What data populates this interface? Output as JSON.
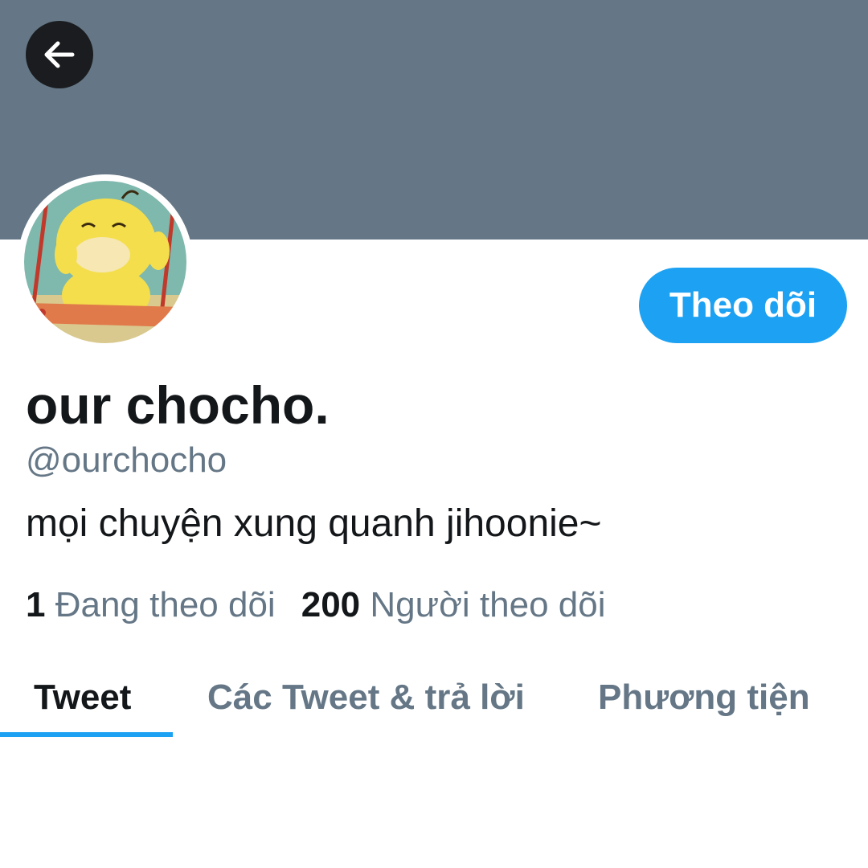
{
  "header": {
    "back_icon": "arrow-left-icon",
    "banner_color": "#657786"
  },
  "profile": {
    "display_name": "our chocho.",
    "handle": "@ourchocho",
    "bio": "mọi chuyện xung quanh jihoonie~",
    "follow_button_label": "Theo dõi",
    "following_count": "1",
    "following_label": "Đang theo dõi",
    "followers_count": "200",
    "followers_label": "Người theo dõi"
  },
  "tabs": [
    {
      "label": "Tweet",
      "active": true
    },
    {
      "label": "Các Tweet & trả lời",
      "active": false
    },
    {
      "label": "Phương tiện",
      "active": false
    }
  ],
  "colors": {
    "accent": "#1da1f2",
    "text_primary": "#14171a",
    "text_secondary": "#657786"
  }
}
